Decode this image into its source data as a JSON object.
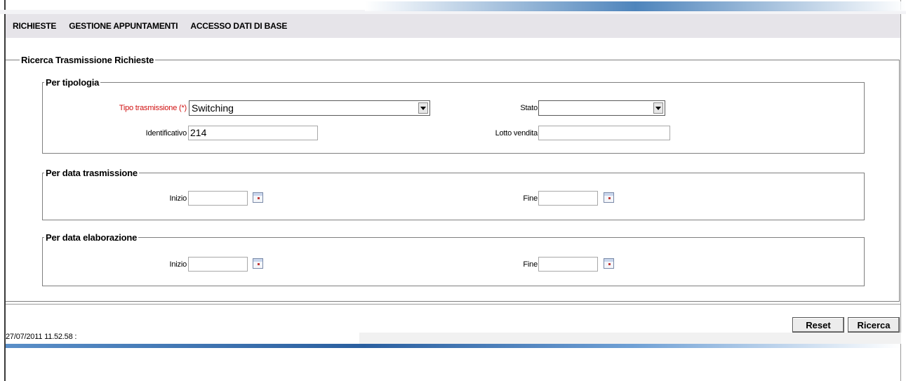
{
  "menu": {
    "items": [
      "RICHIESTE",
      "GESTIONE APPUNTAMENTI",
      "ACCESSO DATI DI BASE"
    ]
  },
  "search": {
    "legend": "Ricerca Trasmissione Richieste",
    "per_tipologia": {
      "legend": "Per tipologia",
      "tipo_trasmissione_label": "Tipo trasmissione (*)",
      "tipo_trasmissione_value": "Switching",
      "stato_label": "Stato",
      "stato_value": "",
      "identificativo_label": "Identificativo",
      "identificativo_value": "214",
      "lotto_vendita_label": "Lotto vendita",
      "lotto_vendita_value": ""
    },
    "per_data_trasmissione": {
      "legend": "Per data trasmissione",
      "inizio_label": "Inizio",
      "inizio_value": "",
      "fine_label": "Fine",
      "fine_value": ""
    },
    "per_data_elaborazione": {
      "legend": "Per data elaborazione",
      "inizio_label": "Inizio",
      "inizio_value": "",
      "fine_label": "Fine",
      "fine_value": ""
    }
  },
  "buttons": {
    "reset": "Reset",
    "ricerca": "Ricerca"
  },
  "status": {
    "timestamp": "27/07/2011 11.52.58  :"
  },
  "colors": {
    "menubar_bg": "#e6e4e9",
    "required_label": "#d01010"
  },
  "icons": {
    "calendar": "calendar-icon",
    "dropdown": "chevron-down-icon"
  }
}
